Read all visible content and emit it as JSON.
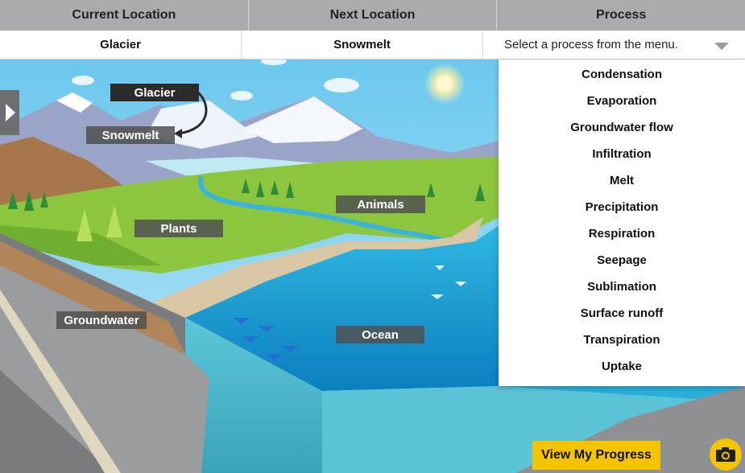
{
  "header": {
    "col_current": "Current Location",
    "col_next": "Next Location",
    "col_process": "Process"
  },
  "row": {
    "current": "Glacier",
    "next": "Snowmelt",
    "process_placeholder": "Select a process from the menu."
  },
  "process_menu": [
    "Condensation",
    "Evaporation",
    "Groundwater flow",
    "Infiltration",
    "Melt",
    "Precipitation",
    "Respiration",
    "Seepage",
    "Sublimation",
    "Surface runoff",
    "Transpiration",
    "Uptake"
  ],
  "scene_labels": {
    "glacier": "Glacier",
    "snowmelt": "Snowmelt",
    "plants": "Plants",
    "animals": "Animals",
    "groundwater": "Groundwater",
    "ocean": "Ocean"
  },
  "buttons": {
    "view_progress": "View My Progress"
  },
  "icons": {
    "side_tab": "play-triangle-icon",
    "camera": "camera-icon",
    "dropdown": "chevron-down-icon",
    "sun": "sun-icon"
  },
  "colors": {
    "accent": "#f5c400",
    "header_bg": "#a9abad",
    "label_bg": "#505050",
    "sky": "#8fd3ef",
    "water": "#1e9ad6"
  }
}
